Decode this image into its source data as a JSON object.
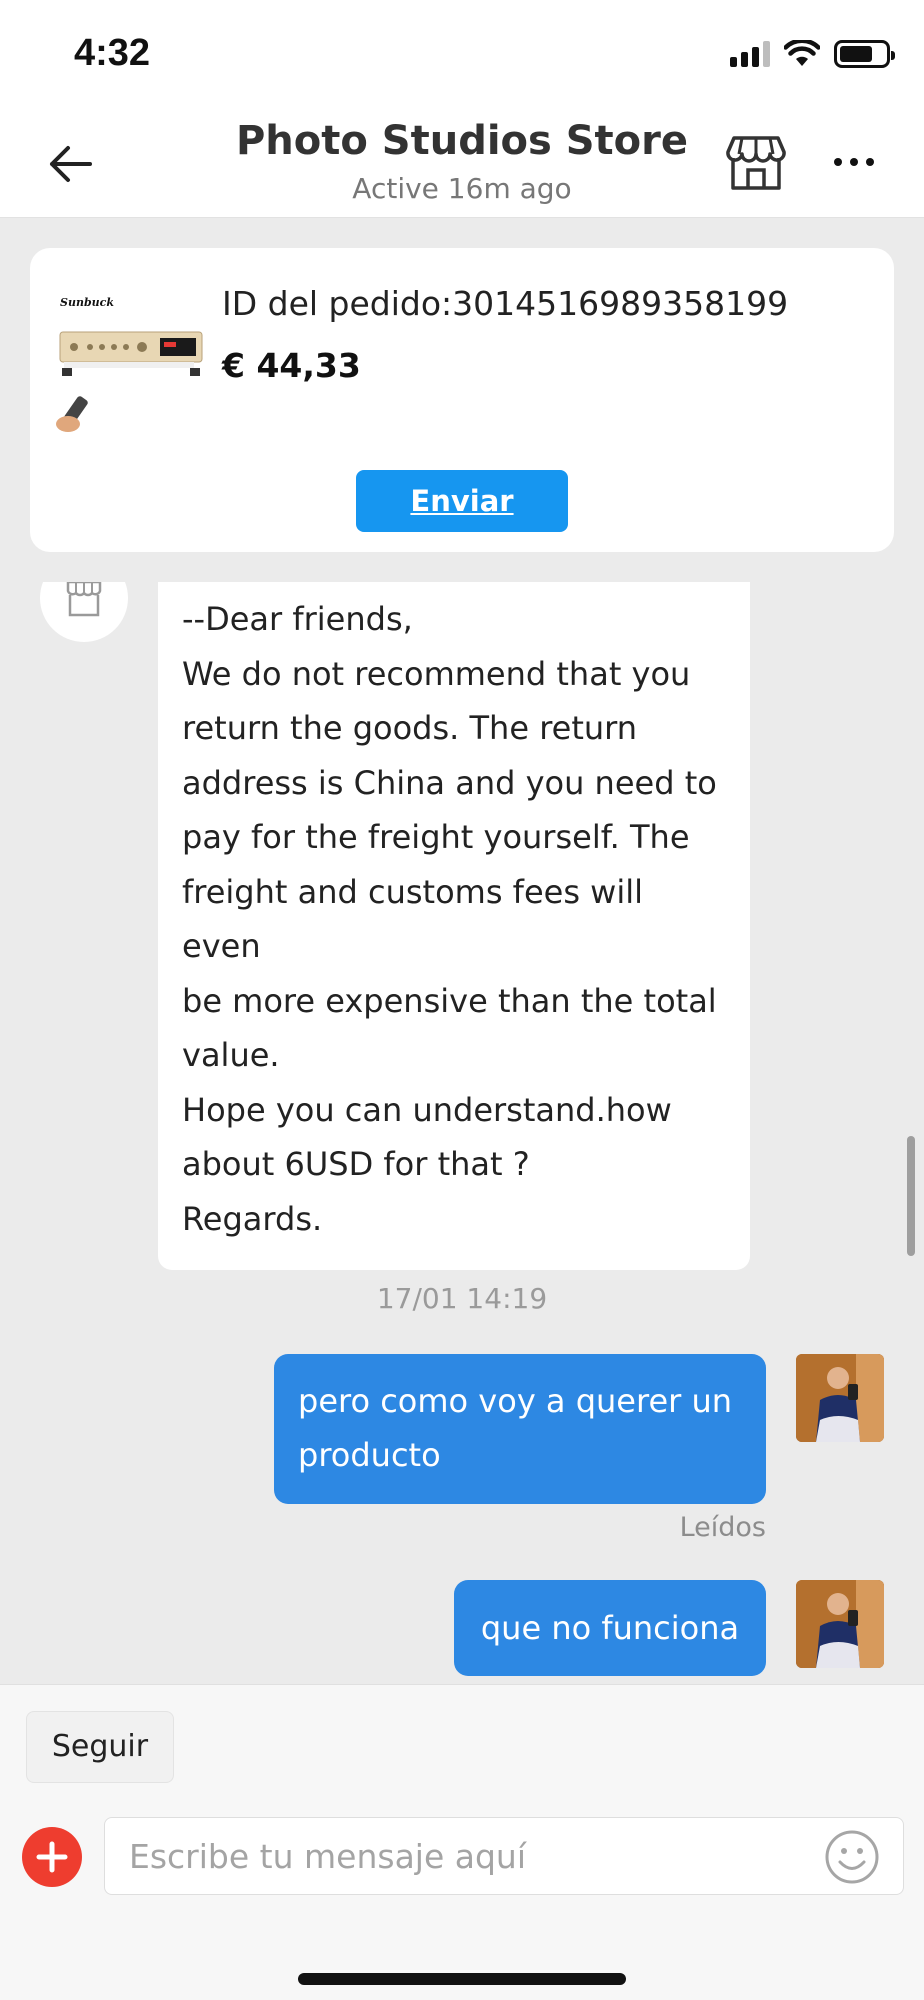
{
  "status_bar": {
    "time": "4:32",
    "icons": [
      "signal-icon",
      "wifi-icon",
      "battery-icon"
    ]
  },
  "header": {
    "title": "Photo Studios Store",
    "subtitle": "Active 16m ago",
    "icons": [
      "back-arrow-icon",
      "store-icon",
      "more-options-icon"
    ]
  },
  "order": {
    "product_brand": "Sunbuck",
    "id_label": "ID del pedido:3014516989358199",
    "price": "€ 44,33",
    "send_label": "Enviar"
  },
  "chat": {
    "incoming": {
      "lines": [
        "--Dear friends,",
        "We do not recommend that you",
        "return the goods. The return",
        "address is China and you need to",
        "pay for the freight yourself. The",
        "freight and customs fees will even",
        "be more expensive than the total",
        "value.",
        "Hope you can understand.how",
        "about 6USD for that ?",
        "Regards."
      ]
    },
    "timestamp": "17/01 14:19",
    "outgoing": [
      {
        "text": "pero como voy a querer un producto",
        "status": "Leídos"
      },
      {
        "text": "que no funciona"
      }
    ]
  },
  "bottom": {
    "follow_label": "Seguir",
    "input_placeholder": "Escribe tu mensaje aquí",
    "icons": [
      "add-icon",
      "emoji-icon"
    ]
  },
  "colors": {
    "accent_blue": "#1696f0",
    "outgoing_bubble": "#2d88e3",
    "add_button_red": "#ee3d2f",
    "background": "#ebebeb"
  }
}
